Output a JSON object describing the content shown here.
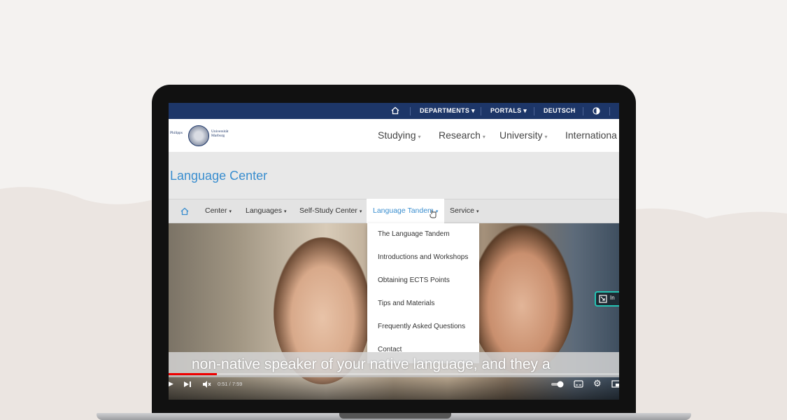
{
  "topbar": {
    "home_icon": "home-icon",
    "items": [
      "DEPARTMENTS",
      "PORTALS",
      "DEUTSCH"
    ],
    "contrast_icon": "contrast-icon"
  },
  "logo": {
    "left": "Philipps",
    "right_line1": "Universität",
    "right_line2": "Marburg"
  },
  "mainnav": [
    "Studying",
    "Research",
    "University",
    "Internationa"
  ],
  "site_title": "Language Center",
  "subnav": {
    "home_icon": "home-icon",
    "items": [
      "Center",
      "Languages",
      "Self-Study Center",
      "Language Tandem",
      "Service"
    ]
  },
  "dropdown": [
    "The Language Tandem",
    "Introductions and Workshops",
    "Obtaining ECTS Points",
    "Tips and Materials",
    "Frequently Asked Questions",
    "Contact"
  ],
  "pip_label": "In",
  "video": {
    "caption": "non-native speaker of your native language, and they a",
    "time": "0:51 / 7:59",
    "progress": 0.107
  },
  "colors": {
    "topbar": "#1d3668",
    "accent": "#3a8ecf",
    "progress": "#e00000"
  }
}
